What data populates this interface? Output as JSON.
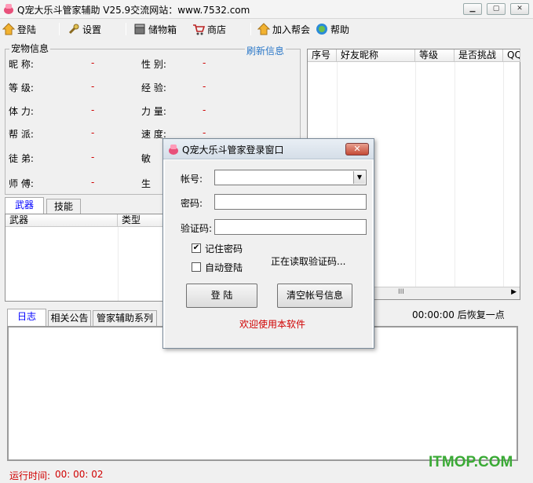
{
  "window": {
    "title": "Q宠大乐斗管家辅助 V25.9交流网站：www.7532.com"
  },
  "toolbar": [
    {
      "label": "登陆",
      "icon": "login-icon"
    },
    {
      "label": "设置",
      "icon": "wrench-icon"
    },
    {
      "label": "储物箱",
      "icon": "storage-icon"
    },
    {
      "label": "商店",
      "icon": "shop-icon"
    },
    {
      "label": "加入帮会",
      "icon": "guild-icon"
    },
    {
      "label": "帮助",
      "icon": "help-icon"
    }
  ],
  "pet": {
    "group_title": "宠物信息",
    "refresh": "刷新信息",
    "fields": [
      {
        "label": "昵    称:",
        "value": "-"
      },
      {
        "label": "性    别:",
        "value": "-"
      },
      {
        "label": "等    级:",
        "value": "-"
      },
      {
        "label": "经    验:",
        "value": "-"
      },
      {
        "label": "体    力:",
        "value": "-"
      },
      {
        "label": "力    量:",
        "value": "-"
      },
      {
        "label": "帮    派:",
        "value": "-"
      },
      {
        "label": "速    度:",
        "value": "-"
      },
      {
        "label": "徒    弟:",
        "value": "-"
      },
      {
        "label": "敏",
        "value": ""
      },
      {
        "label": "师    傅:",
        "value": "-"
      },
      {
        "label": "生",
        "value": ""
      }
    ]
  },
  "friends": {
    "columns": [
      "序号",
      "好友昵称",
      "等级",
      "是否挑战",
      "QQ"
    ],
    "scroll_glyph": "III"
  },
  "weapons": {
    "tabs": [
      "武器",
      "技能"
    ],
    "columns": [
      "武器",
      "类型"
    ]
  },
  "log": {
    "tabs": [
      "日志",
      "相关公告",
      "管家辅助系列"
    ],
    "restore_text": "00:00:00 后恢复一点"
  },
  "status": {
    "runtime_label": "运行时间:",
    "runtime_value": "00: 00: 02"
  },
  "watermark": "ITMOP.COM",
  "dialog": {
    "title": "Q宠大乐斗管家登录窗口",
    "account_label": "帐号:",
    "password_label": "密码:",
    "captcha_label": "验证码:",
    "account_value": "",
    "password_value": "",
    "captcha_value": "",
    "remember_label": "记住密码",
    "remember_checked": true,
    "autologin_label": "自动登陆",
    "autologin_checked": false,
    "reading_status": "正在读取验证码...",
    "login_button": "登   陆",
    "clear_button": "清空帐号信息",
    "welcome": "欢迎使用本软件"
  },
  "colors": {
    "accent_red": "#d00000",
    "link_blue": "#0000ff",
    "refresh_blue": "#2b78c8",
    "watermark_green": "#3aaa35"
  }
}
